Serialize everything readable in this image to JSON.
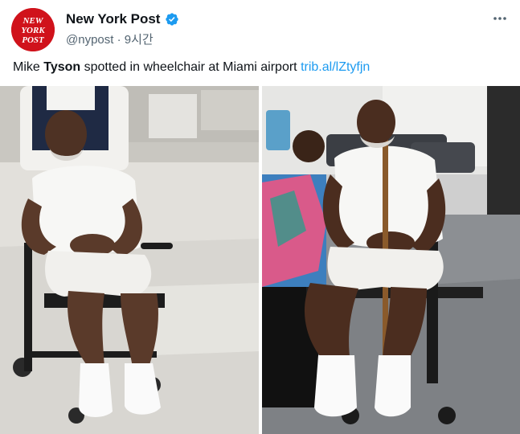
{
  "account": {
    "display_name": "New York Post",
    "handle": "@nypost",
    "separator": "·",
    "time_ago": "9시간",
    "logo_lines": [
      "NEW",
      "YORK",
      "POST"
    ],
    "verified_color": "#1d9bf0",
    "brand_color": "#d0121b"
  },
  "tweet": {
    "text_before": "Mike ",
    "text_bold": "Tyson",
    "text_after": " spotted in wheelchair at Miami airport ",
    "link": "trib.al/lZtyfjn"
  },
  "icons": {
    "verified": "verified-badge-icon",
    "more": "more-options-icon"
  },
  "media": {
    "left_photo": "man-in-wheelchair-airport-photo",
    "right_photo": "man-in-wheelchair-with-fan-selfie-photo"
  }
}
